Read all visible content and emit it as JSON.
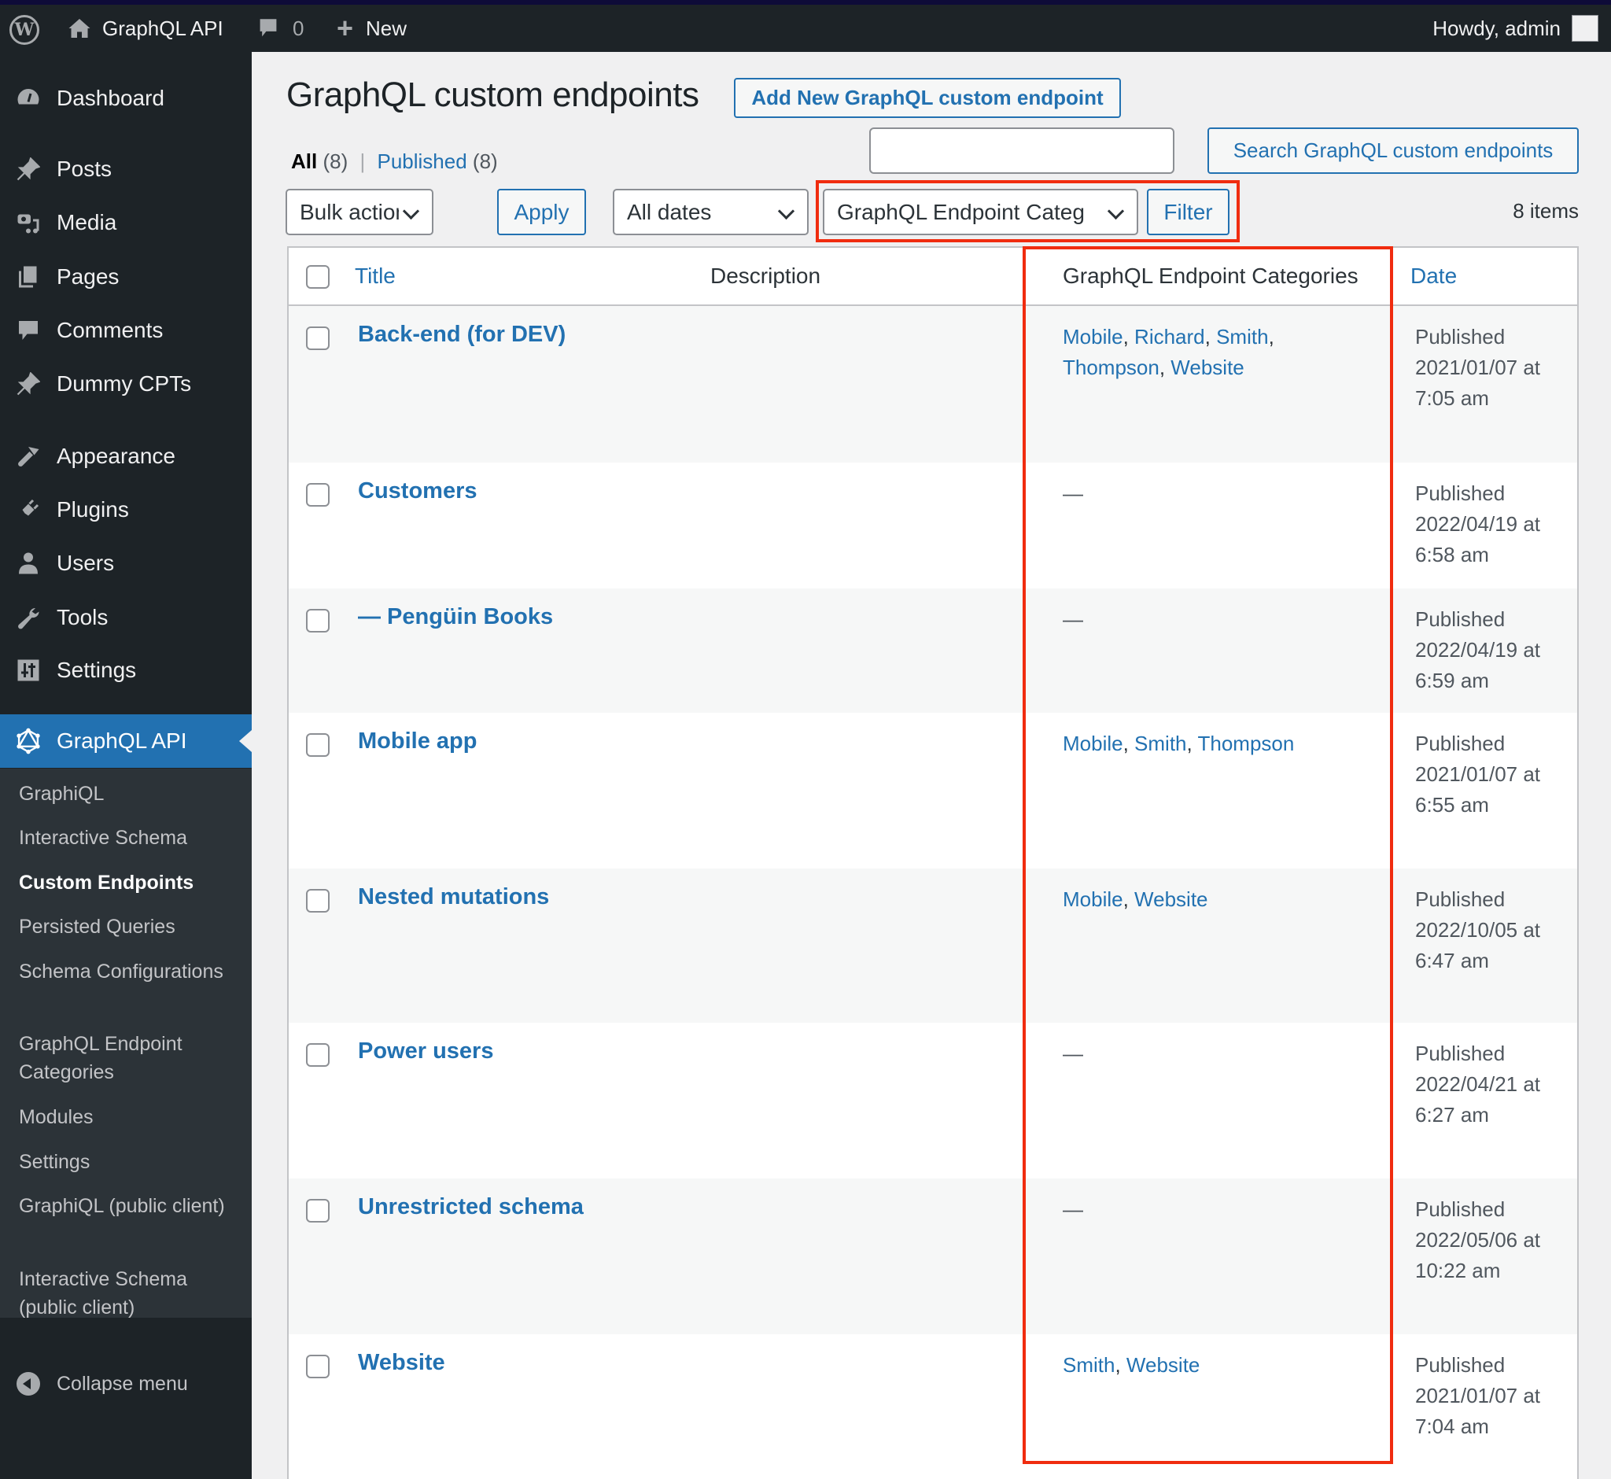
{
  "adminbar": {
    "site_name": "GraphQL API",
    "comments_count": "0",
    "new_label": "New",
    "howdy": "Howdy, admin"
  },
  "sidebar": {
    "items": [
      {
        "label": "Dashboard",
        "icon": "dashboard-icon"
      },
      {
        "label": "Posts",
        "icon": "pin-icon"
      },
      {
        "label": "Media",
        "icon": "media-icon"
      },
      {
        "label": "Pages",
        "icon": "pages-icon"
      },
      {
        "label": "Comments",
        "icon": "comment-icon"
      },
      {
        "label": "Dummy CPTs",
        "icon": "pin-icon"
      },
      {
        "label": "Appearance",
        "icon": "brush-icon"
      },
      {
        "label": "Plugins",
        "icon": "plug-icon"
      },
      {
        "label": "Users",
        "icon": "user-icon"
      },
      {
        "label": "Tools",
        "icon": "wrench-icon"
      },
      {
        "label": "Settings",
        "icon": "settings-icon"
      },
      {
        "label": "GraphQL API",
        "icon": "graphql-icon",
        "active": true
      }
    ],
    "submenu": [
      "GraphiQL",
      "Interactive Schema",
      "Custom Endpoints",
      "Persisted Queries",
      "Schema Configurations",
      "GraphQL Endpoint Categories",
      "Modules",
      "Settings",
      "GraphiQL (public client)",
      "Interactive Schema (public client)"
    ],
    "submenu_current": "Custom Endpoints",
    "collapse_label": "Collapse menu"
  },
  "page": {
    "title": "GraphQL custom endpoints",
    "add_new_label": "Add New GraphQL custom endpoint",
    "views": {
      "all_label": "All",
      "all_count": "(8)",
      "separator": "|",
      "published_label": "Published",
      "published_count": "(8)"
    },
    "search": {
      "value": "",
      "button_label": "Search GraphQL custom endpoints"
    },
    "toolbar": {
      "bulk_actions": "Bulk actions",
      "apply_label": "Apply",
      "dates": "All dates",
      "categories": "GraphQL Endpoint Categ",
      "filter_label": "Filter",
      "items_count": "8 items"
    }
  },
  "table": {
    "columns": {
      "title": "Title",
      "description": "Description",
      "categories": "GraphQL Endpoint Categories",
      "date": "Date"
    },
    "rows": [
      {
        "title": "Back-end (for DEV)",
        "description": "",
        "categories": [
          "Mobile",
          "Richard",
          "Smith",
          "Thompson",
          "Website"
        ],
        "status": "Published",
        "date": "2021/01/07 at",
        "time": "7:05 am"
      },
      {
        "title": "Customers",
        "description": "",
        "categories": [],
        "status": "Published",
        "date": "2022/04/19 at",
        "time": "6:58 am"
      },
      {
        "title": "— Pengüin Books",
        "description": "",
        "categories": [],
        "status": "Published",
        "date": "2022/04/19 at",
        "time": "6:59 am"
      },
      {
        "title": "Mobile app",
        "description": "",
        "categories": [
          "Mobile",
          "Smith",
          "Thompson"
        ],
        "status": "Published",
        "date": "2021/01/07 at",
        "time": "6:55 am"
      },
      {
        "title": "Nested mutations",
        "description": "",
        "categories": [
          "Mobile",
          "Website"
        ],
        "status": "Published",
        "date": "2022/10/05 at",
        "time": "6:47 am"
      },
      {
        "title": "Power users",
        "description": "",
        "categories": [],
        "status": "Published",
        "date": "2022/04/21 at",
        "time": "6:27 am"
      },
      {
        "title": "Unrestricted schema",
        "description": "",
        "categories": [],
        "status": "Published",
        "date": "2022/05/06 at",
        "time": "10:22 am"
      },
      {
        "title": "Website",
        "description": "",
        "categories": [
          "Smith",
          "Website"
        ],
        "status": "Published",
        "date": "2021/01/07 at",
        "time": "7:04 am"
      }
    ],
    "empty_placeholder": "—"
  },
  "colors": {
    "accent": "#2271b1",
    "highlight": "#f02c0f",
    "sidebar_bg": "#1d2327",
    "submenu_bg": "#2c3338"
  }
}
